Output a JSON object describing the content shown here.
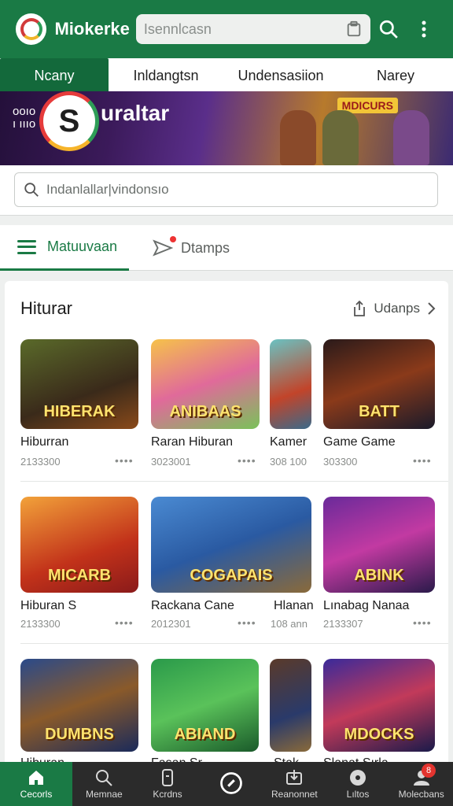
{
  "topbar": {
    "app_name": "Miokerke",
    "search_placeholder": "Isennlcasn"
  },
  "tabs": [
    {
      "label": "Ncany"
    },
    {
      "label": "Inldangtsn"
    },
    {
      "label": "Undensasiion"
    },
    {
      "label": "Narey"
    }
  ],
  "banner": {
    "left_text_1": "ooıo",
    "left_text_2": "ı ıııo",
    "logo_letter": "S",
    "brand": "uraltar",
    "tag": "MDICURS"
  },
  "search": {
    "placeholder": "Indanlallar|vindonsıo"
  },
  "segments": {
    "first": "Matuuvaan",
    "second": "Dtamps"
  },
  "section": {
    "title": "Hiturar",
    "more_label": "Udanps"
  },
  "rows": [
    {
      "items": [
        {
          "title": "Hiburran",
          "meta": "2133300",
          "caption": "HIBERAK"
        },
        {
          "title": "Raran Hiburan",
          "meta": "3023001",
          "caption": "ANIBAAS"
        },
        {
          "title": "Kamer",
          "meta": "308 100",
          "caption": ""
        },
        {
          "title": "Game Game",
          "meta": "303300",
          "caption": "BATT"
        }
      ]
    },
    {
      "items": [
        {
          "title": "Hiburan S",
          "meta": "2133300",
          "caption": "MICARB"
        },
        {
          "title": "Rackana Cane",
          "meta": "2012301",
          "caption": "COGAPAIS"
        },
        {
          "title": "Hlanan",
          "meta": "108 ann",
          "caption": ""
        },
        {
          "title": "Lınabag Nanaa",
          "meta": "2133307",
          "caption": "ABINK"
        }
      ]
    },
    {
      "items": [
        {
          "title": "Hiburan",
          "meta": "",
          "caption": "DUMBNS"
        },
        {
          "title": "Fasan Sr",
          "meta": "",
          "caption": "ABIAND"
        },
        {
          "title": "Stak",
          "meta": "",
          "caption": ""
        },
        {
          "title": "Slanat Sırla",
          "meta": "",
          "caption": "MDOCKS"
        }
      ]
    }
  ],
  "bottomnav": [
    {
      "label": "Cecorls",
      "icon": "home-icon"
    },
    {
      "label": "Memnae",
      "icon": "search-icon"
    },
    {
      "label": "Kcrdns",
      "icon": "phone-icon"
    },
    {
      "label": "",
      "icon": "compass-icon"
    },
    {
      "label": "Reanonnet",
      "icon": "download-icon"
    },
    {
      "label": "Lıltos",
      "icon": "disc-icon"
    },
    {
      "label": "Molecbans",
      "icon": "profile-icon",
      "badge": "8"
    }
  ]
}
